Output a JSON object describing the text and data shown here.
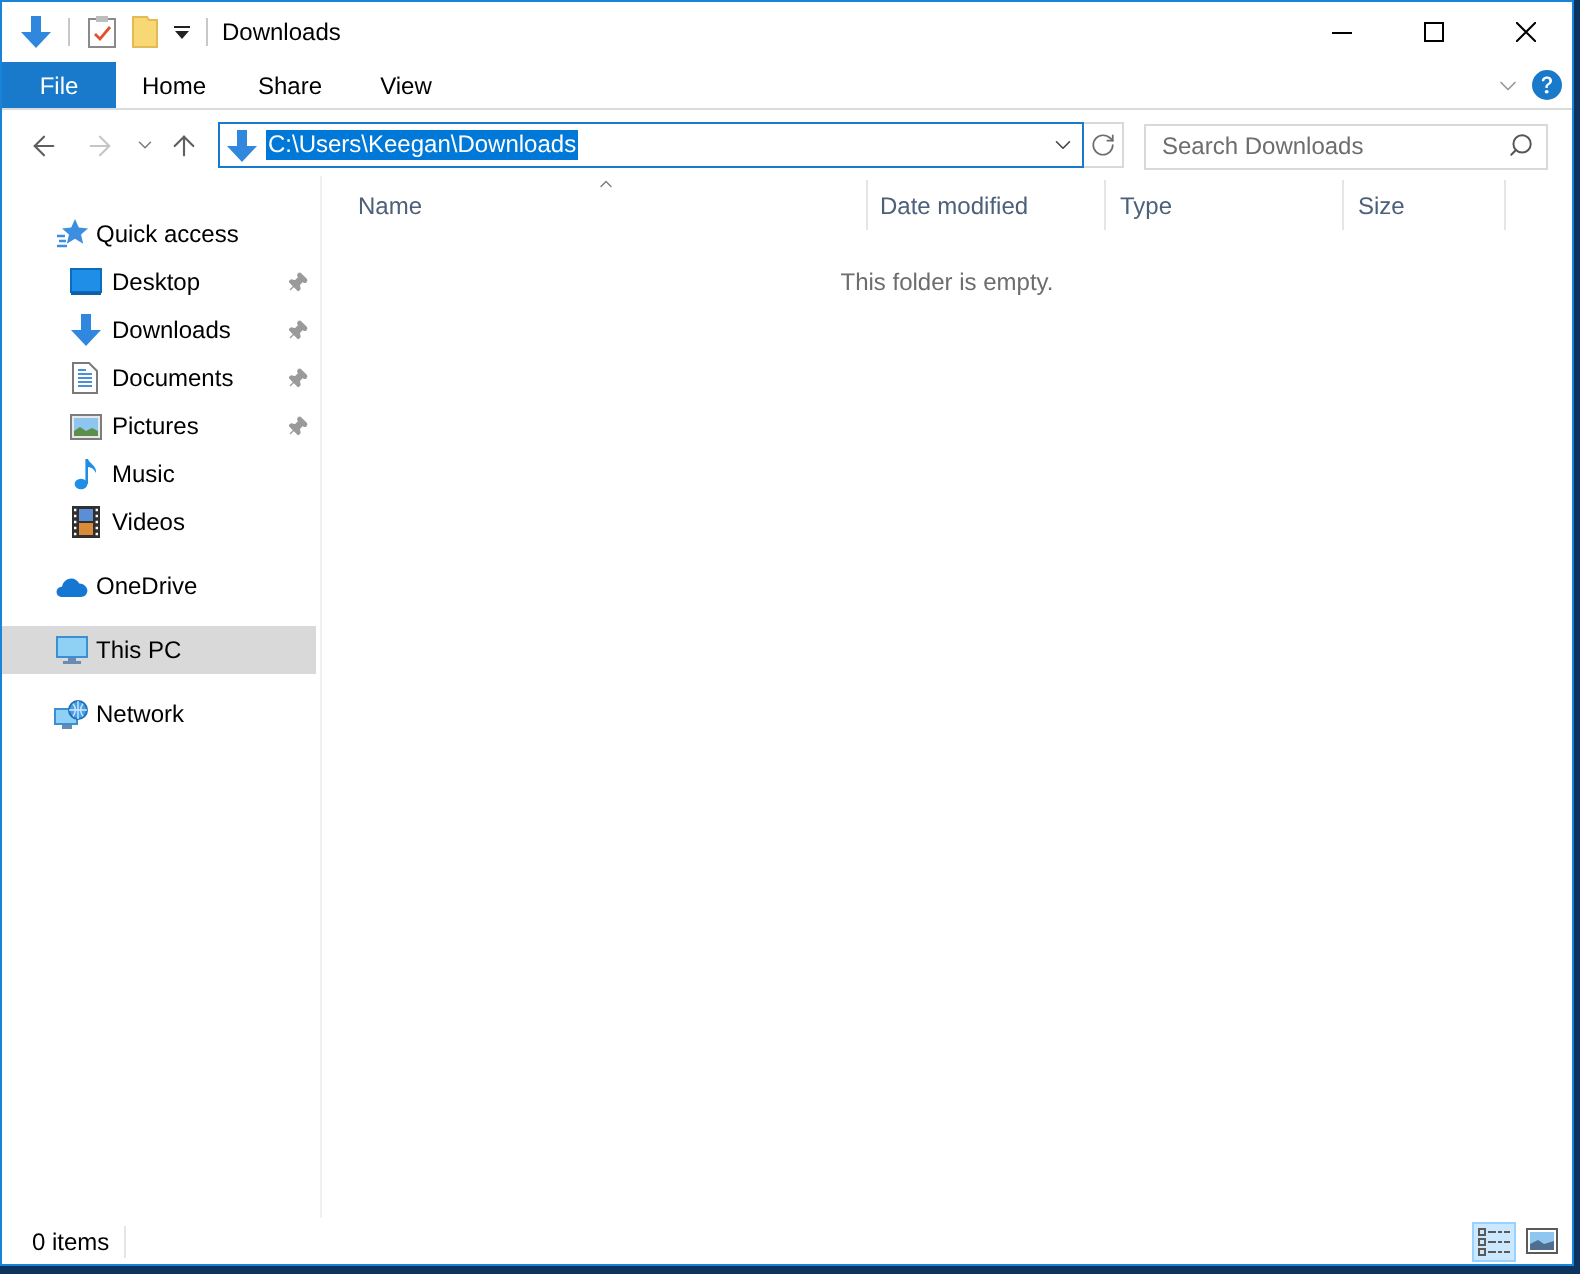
{
  "window": {
    "title": "Downloads"
  },
  "ribbon": {
    "tabs": [
      {
        "label": "File",
        "kind": "file-menu"
      },
      {
        "label": "Home",
        "kind": "tab"
      },
      {
        "label": "Share",
        "kind": "tab"
      },
      {
        "label": "View",
        "kind": "tab"
      }
    ],
    "minimized": true
  },
  "navigation": [
    {
      "kind": "back",
      "disabled": false
    },
    {
      "kind": "forward",
      "disabled": true
    },
    {
      "kind": "recent",
      "disabled": false
    },
    {
      "kind": "up",
      "disabled": false
    }
  ],
  "address_bar": {
    "path": "C:\\Users\\Keegan\\Downloads",
    "path_selected": true
  },
  "search": {
    "placeholder": "Search Downloads"
  },
  "sidebar": {
    "items": [
      {
        "label": "Quick access",
        "kind": "quick-access",
        "selected": false,
        "children": [
          {
            "label": "Desktop",
            "kind": "desktop",
            "pinned": true,
            "selected": false
          },
          {
            "label": "Downloads",
            "kind": "downloads",
            "pinned": true,
            "selected": false
          },
          {
            "label": "Documents",
            "kind": "documents",
            "pinned": true,
            "selected": false
          },
          {
            "label": "Pictures",
            "kind": "pictures",
            "pinned": true,
            "selected": false
          },
          {
            "label": "Music",
            "kind": "music",
            "pinned": false,
            "selected": false
          },
          {
            "label": "Videos",
            "kind": "videos",
            "pinned": false,
            "selected": false
          }
        ]
      },
      {
        "label": "OneDrive",
        "kind": "onedrive",
        "selected": false
      },
      {
        "label": "This PC",
        "kind": "this-pc",
        "selected": true
      },
      {
        "label": "Network",
        "kind": "network",
        "selected": false
      }
    ]
  },
  "file_list": {
    "columns": [
      {
        "label": "Name",
        "sorted": true
      },
      {
        "label": "Date modified",
        "sorted": false
      },
      {
        "label": "Type",
        "sorted": false
      },
      {
        "label": "Size",
        "sorted": false
      }
    ],
    "empty_message": "This folder is empty."
  },
  "status_bar": {
    "item_count": "0 items",
    "views": [
      {
        "kind": "details",
        "selected": true
      },
      {
        "kind": "large-icons",
        "selected": false
      }
    ]
  }
}
